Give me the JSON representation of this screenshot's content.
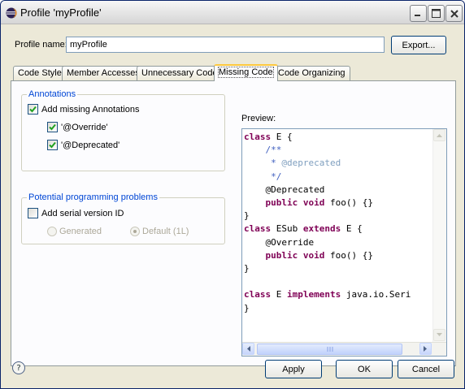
{
  "window": {
    "title": "Profile 'myProfile'"
  },
  "profile": {
    "name_label": "Profile name:",
    "name_value": "myProfile",
    "export_button": "Export..."
  },
  "tabs": [
    {
      "label": "Code Style",
      "active": false
    },
    {
      "label": "Member Accesses",
      "active": false
    },
    {
      "label": "Unnecessary Code",
      "active": false
    },
    {
      "label": "Missing Code",
      "active": true
    },
    {
      "label": "Code Organizing",
      "active": false
    }
  ],
  "annotations": {
    "group_title": "Annotations",
    "add_missing": {
      "label": "Add missing Annotations",
      "checked": true
    },
    "override": {
      "label": "'@Override'",
      "checked": true
    },
    "deprecated": {
      "label": "'@Deprecated'",
      "checked": true
    }
  },
  "problems": {
    "group_title": "Potential programming problems",
    "add_serial": {
      "label": "Add serial version ID",
      "checked": false
    },
    "generated": {
      "label": "Generated",
      "selected": false
    },
    "default": {
      "label": "Default (1L)",
      "selected": true
    }
  },
  "preview": {
    "label": "Preview:",
    "lines": [
      "class E {",
      "    /**",
      "     * @deprecated",
      "     */",
      "    @Deprecated",
      "    public void foo() {}",
      "}",
      "class ESub extends E {",
      "    @Override",
      "    public void foo() {}",
      "}",
      "",
      "class E implements java.io.Seri",
      "}"
    ]
  },
  "buttons": {
    "apply": "Apply",
    "ok": "OK",
    "cancel": "Cancel"
  },
  "colors": {
    "keyword": "#7f0055",
    "javadoc": "#3f5fbf",
    "group_title": "#0046d5",
    "active_tab_accent": "#ffc83c"
  }
}
